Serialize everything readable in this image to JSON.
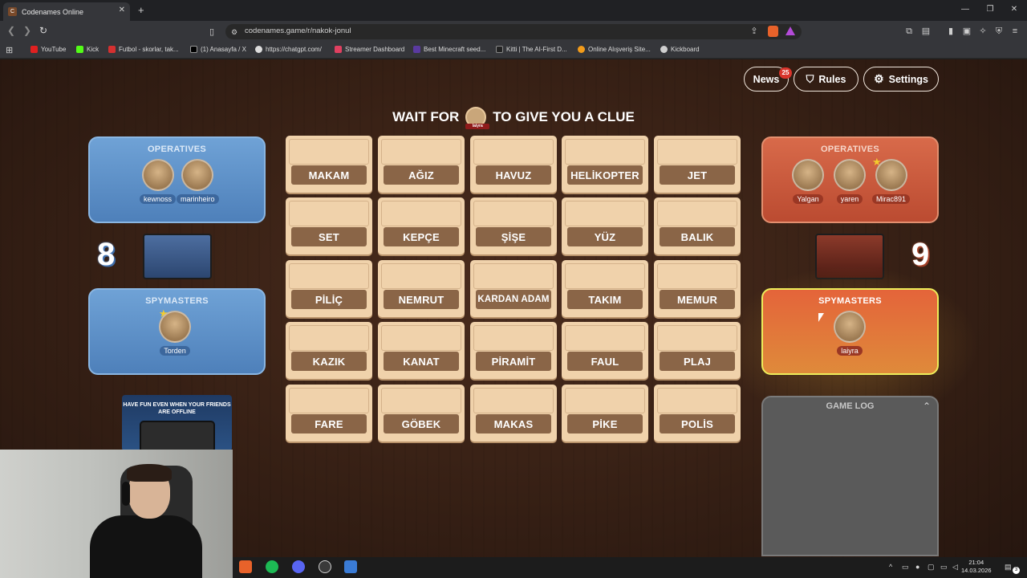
{
  "browser": {
    "tab_title": "Codenames Online",
    "url": "codenames.game/r/nakok-jonul",
    "bookmarks": [
      "YouTube",
      "Kick",
      "Futbol - skorlar, tak...",
      "(1) Anasayfa / X",
      "https://chatgpt.com/",
      "Streamer Dashboard",
      "Best Minecraft seed...",
      "Kitti | The AI-First D...",
      "Online Alışveriş Site...",
      "Kickboard"
    ]
  },
  "header": {
    "news_label": "News",
    "news_count": "25",
    "rules_label": "Rules",
    "settings_label": "Settings"
  },
  "headline": {
    "before": "WAIT FOR",
    "after": "TO GIVE YOU A CLUE",
    "avatar_name": "laiyra"
  },
  "blue_team": {
    "score": "8",
    "operatives_title": "OPERATIVES",
    "operatives": [
      "kewnoss",
      "marinheiro"
    ],
    "spymasters_title": "SPYMASTERS",
    "spymasters": [
      "Torden"
    ]
  },
  "red_team": {
    "score": "9",
    "operatives_title": "OPERATIVES",
    "operatives": [
      "Yalgan",
      "yaren",
      "Mirac891"
    ],
    "spymasters_title": "SPYMASTERS",
    "spymasters": [
      "laiyra"
    ]
  },
  "board": {
    "words": [
      "MAKAM",
      "AĞIZ",
      "HAVUZ",
      "HELİKOPTER",
      "JET",
      "SET",
      "KEPÇE",
      "ŞİŞE",
      "YÜZ",
      "BALIK",
      "PİLİÇ",
      "NEMRUT",
      "KARDAN ADAM",
      "TAKIM",
      "MEMUR",
      "KAZIK",
      "KANAT",
      "PİRAMİT",
      "FAUL",
      "PLAJ",
      "FARE",
      "GÖBEK",
      "MAKAS",
      "PİKE",
      "POLİS"
    ]
  },
  "game_log": {
    "title": "GAME LOG"
  },
  "promo": {
    "text": "HAVE FUN EVEN WHEN YOUR FRIENDS ARE OFFLINE"
  },
  "taskbar": {
    "time": "21:04",
    "date": "14.03.2026",
    "notif_count": "3"
  }
}
